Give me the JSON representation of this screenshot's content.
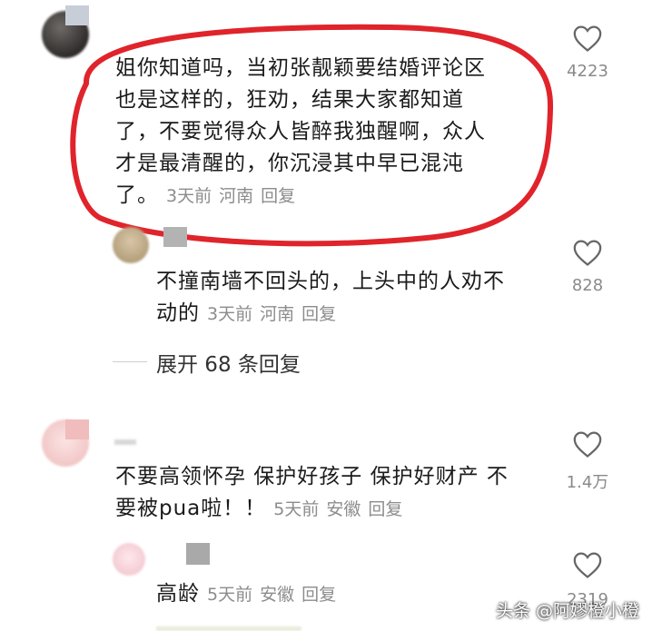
{
  "comments": [
    {
      "text": "姐你知道吗，当初张靓颖要结婚评论区也是这样的，狂劝，结果大家都知道了，不要觉得众人皆醉我独醒啊，众人才是最清醒的，你沉浸其中早已混沌了。",
      "lines": [
        "姐你知道吗，当初张靓颖要结婚评论区",
        "也是这样的，狂劝，结果大家都知道",
        "了，不要觉得众人皆醉我独醒啊，众人",
        "才是最清醒的，你沉浸其中早已混沌",
        "了。"
      ],
      "time": "3天前",
      "location": "河南",
      "reply": "回复",
      "likes": "4223"
    },
    {
      "lines": [
        "不撞南墙不回头的，上头中的人劝不",
        "动的"
      ],
      "time": "3天前",
      "location": "河南",
      "reply": "回复",
      "likes": "828"
    },
    {
      "lines": [
        "不要高领怀孕 保护好孩子 保护好财产 不",
        "要被pua啦！！"
      ],
      "time": "5天前",
      "location": "安徽",
      "reply": "回复",
      "likes": "1.4万"
    },
    {
      "lines": [
        "高龄"
      ],
      "time": "5天前",
      "location": "安徽",
      "reply": "回复",
      "likes": "2319"
    }
  ],
  "expand_replies": "展开 68 条回复",
  "watermark": "头条 @阿嫪橙小橙",
  "colors": {
    "highlight_circle": "#e0242b",
    "meta": "#8c8c8c",
    "text": "#1b1b1b"
  }
}
